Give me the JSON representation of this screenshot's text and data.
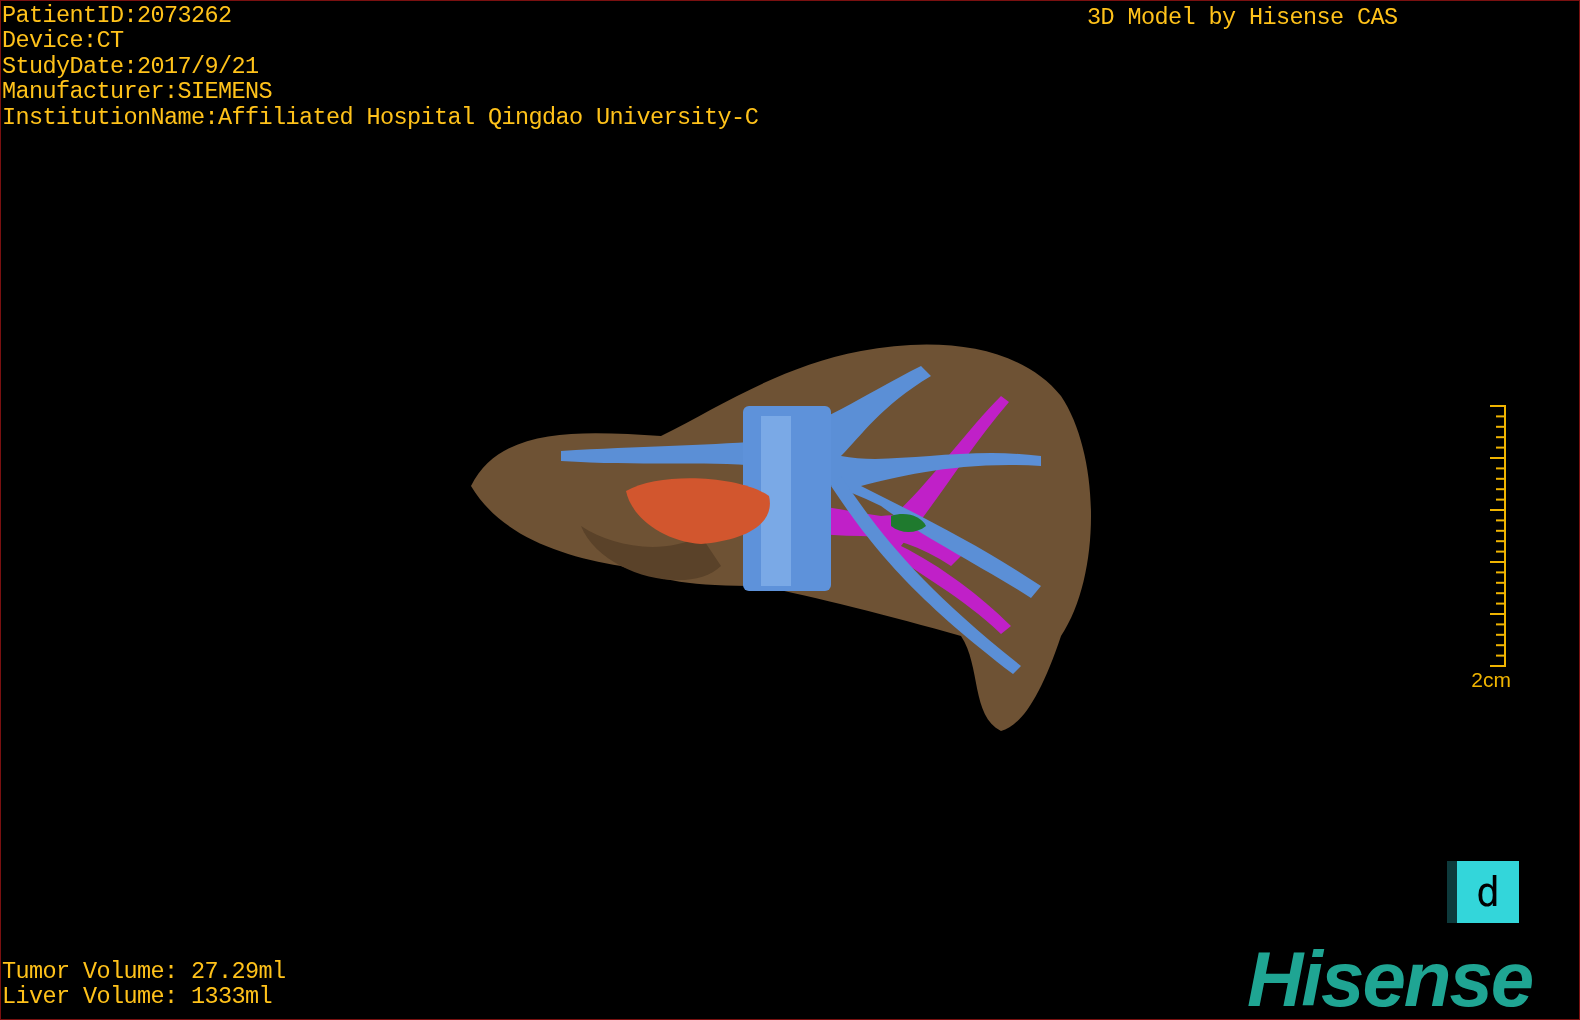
{
  "patient_info": [
    "PatientID:2073262",
    "Device:CT",
    "StudyDate:2017/9/21",
    "Manufacturer:SIEMENS",
    "InstitutionName:Affiliated Hospital Qingdao University-C"
  ],
  "title": "3D Model by Hisense CAS",
  "scale_bar": {
    "label": "2cm"
  },
  "view_tile": {
    "label": "d"
  },
  "volumes": [
    "Tumor Volume: 27.29ml",
    "Liver Volume: 1333ml"
  ],
  "logo": {
    "text": "Hisense"
  }
}
